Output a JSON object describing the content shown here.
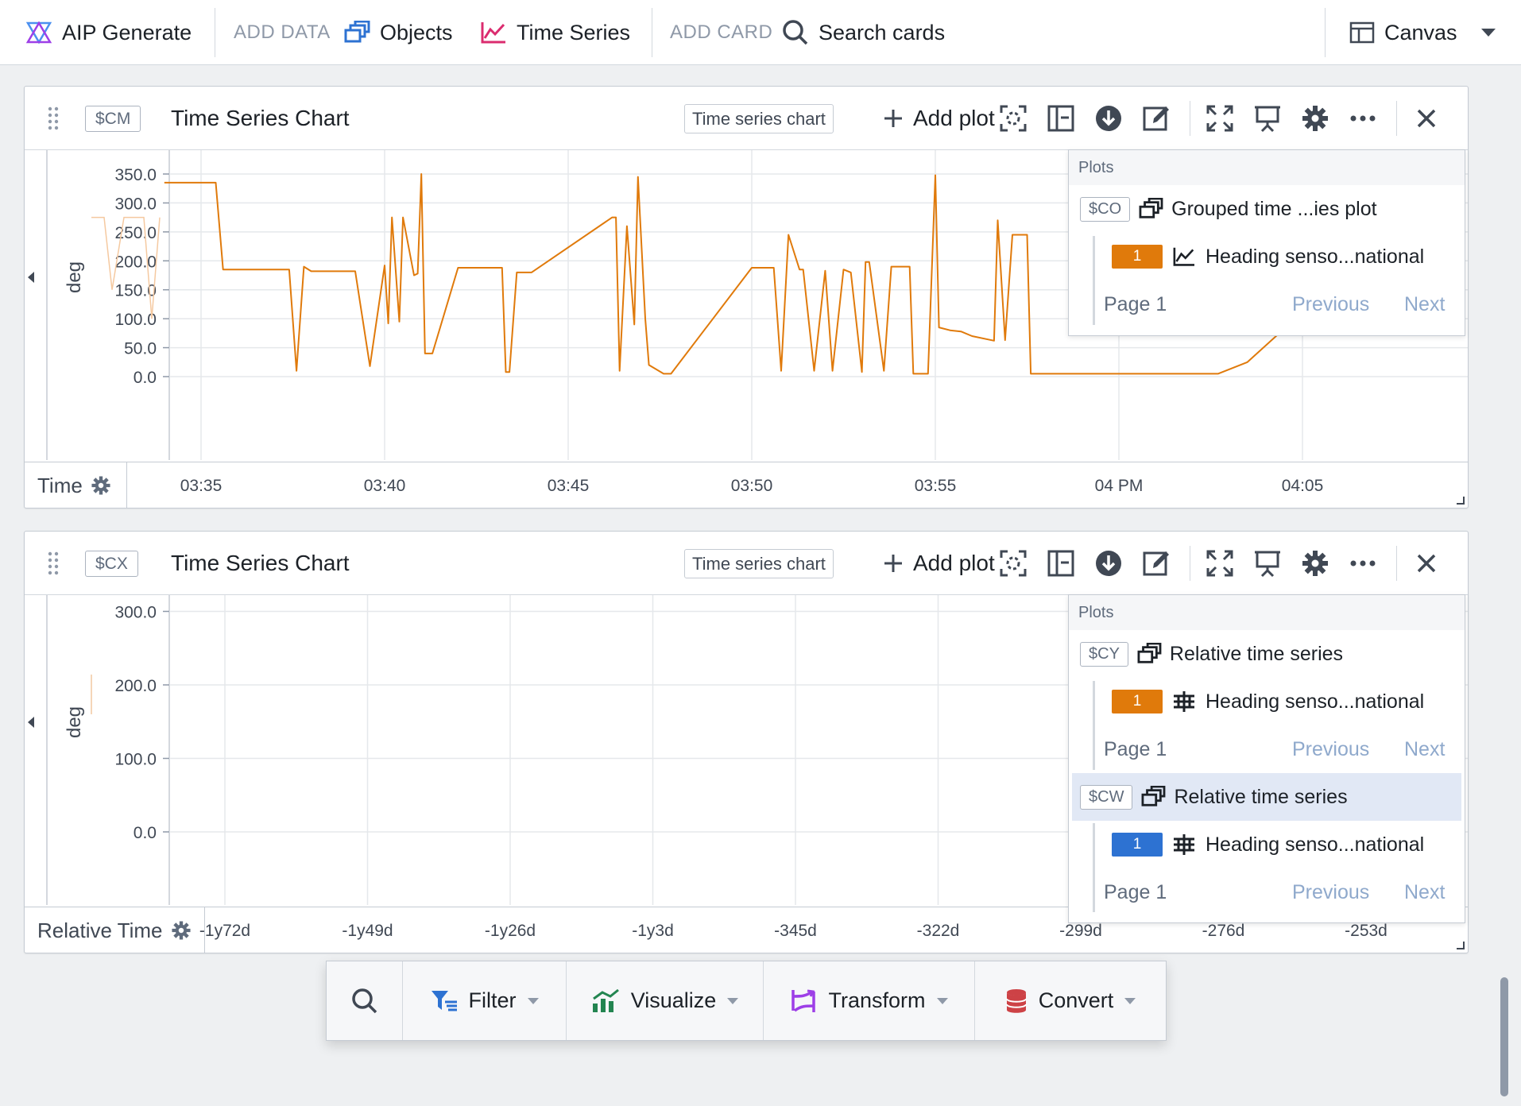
{
  "toolbar": {
    "aip_label": "AIP Generate",
    "add_data_label": "ADD DATA",
    "objects_label": "Objects",
    "time_series_label": "Time Series",
    "add_card_label": "ADD CARD",
    "search_label": "Search cards",
    "canvas_label": "Canvas"
  },
  "cards": [
    {
      "var": "$CM",
      "title": "Time Series Chart",
      "type_tag": "Time series chart",
      "add_plot": "Add plot",
      "y_axis_label": "deg",
      "x_axis_name": "Time",
      "plots_header": "Plots",
      "plots": [
        {
          "tag": "$CO",
          "name": "Grouped time ...ies plot",
          "series": {
            "badge": "1",
            "color": "#e07a0b",
            "name": "Heading senso...national"
          },
          "page": "Page 1",
          "prev": "Previous",
          "next": "Next"
        }
      ]
    },
    {
      "var": "$CX",
      "title": "Time Series Chart",
      "type_tag": "Time series chart",
      "add_plot": "Add plot",
      "y_axis_label": "deg",
      "x_axis_name": "Relative Time",
      "plots_header": "Plots",
      "plots": [
        {
          "tag": "$CY",
          "name": "Relative time series",
          "series": {
            "badge": "1",
            "color": "#e07a0b",
            "name": "Heading senso...national"
          },
          "page": "Page 1",
          "prev": "Previous",
          "next": "Next"
        },
        {
          "tag": "$CW",
          "name": "Relative time series",
          "selected": true,
          "series": {
            "badge": "1",
            "color": "#2d72d2",
            "name": "Heading senso...national"
          },
          "page": "Page 1",
          "prev": "Previous",
          "next": "Next"
        }
      ]
    }
  ],
  "chart_data": [
    {
      "type": "line",
      "ylabel": "deg",
      "xlabel": "Time",
      "ylim": [
        0,
        350
      ],
      "y_ticks": [
        "350.0",
        "300.0",
        "250.0",
        "200.0",
        "150.0",
        "100.0",
        "50.0",
        "0.0"
      ],
      "x_ticks": [
        "03:35",
        "03:40",
        "03:45",
        "03:50",
        "03:55",
        "04 PM",
        "04:05"
      ],
      "series": [
        {
          "color": "#e07a0b",
          "x": [
            "03:34.0",
            "03:35.4",
            "03:35.6",
            "03:37.4",
            "03:37.6",
            "03:37.8",
            "03:38.0",
            "03:39.2",
            "03:39.6",
            "03:40.0",
            "03:40.0",
            "03:40.1",
            "03:40.2",
            "03:40.4",
            "03:40.5",
            "03:40.8",
            "03:40.9",
            "03:41.0",
            "03:41.1",
            "03:41.3",
            "03:42.0",
            "03:43.2",
            "03:43.3",
            "03:43.4",
            "03:43.6",
            "03:44.0",
            "03:46.2",
            "03:46.3",
            "03:46.4",
            "03:46.6",
            "03:46.8",
            "03:46.9",
            "03:47.1",
            "03:47.2",
            "03:47.6",
            "03:47.8",
            "03:50.0",
            "03:50.6",
            "03:50.8",
            "03:51.0",
            "03:51.3",
            "03:51.4",
            "03:51.7",
            "03:52.0",
            "03:52.2",
            "03:52.5",
            "03:52.7",
            "03:53.0",
            "03:53.1",
            "03:53.2",
            "03:53.6",
            "03:53.8",
            "03:54.3",
            "03:54.4",
            "03:54.8",
            "03:55.0",
            "03:55.1",
            "03:55.4",
            "03:55.7",
            "03:56.0",
            "03:56.6",
            "03:56.7",
            "03:56.9",
            "03:57.1",
            "03:57.2",
            "03:57.5",
            "03:57.6",
            "03:58.0",
            "04:02.7",
            "04:03.5",
            "04:05.5"
          ],
          "y": [
            335,
            335,
            185,
            185,
            10,
            190,
            182,
            182,
            18,
            192,
            192,
            92,
            275,
            95,
            275,
            175,
            178,
            350,
            40,
            40,
            188,
            188,
            8,
            8,
            180,
            180,
            275,
            275,
            10,
            260,
            90,
            345,
            100,
            20,
            5,
            5,
            188,
            188,
            10,
            245,
            185,
            185,
            10,
            183,
            10,
            185,
            180,
            8,
            198,
            198,
            10,
            190,
            190,
            5,
            5,
            348,
            85,
            80,
            78,
            70,
            62,
            270,
            63,
            245,
            245,
            245,
            5,
            5,
            5,
            25,
            140
          ]
        }
      ]
    },
    {
      "type": "line",
      "ylabel": "deg",
      "xlabel": "Relative Time",
      "ylim": [
        0,
        350
      ],
      "y_ticks": [
        "300.0",
        "200.0",
        "100.0",
        "0.0"
      ],
      "x_ticks": [
        "-1y72d",
        "-1y49d",
        "-1y26d",
        "-1y3d",
        "-345d",
        "-322d",
        "-299d",
        "-276d",
        "-253d"
      ],
      "series": []
    }
  ],
  "action_bar": {
    "filter": "Filter",
    "visualize": "Visualize",
    "transform": "Transform",
    "convert": "Convert"
  }
}
